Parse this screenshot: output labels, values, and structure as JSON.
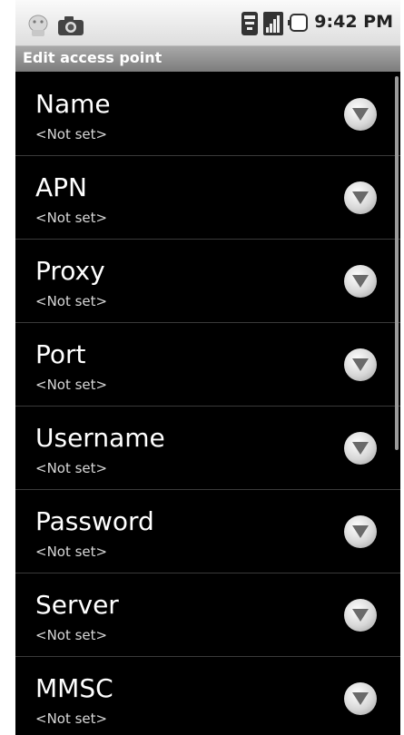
{
  "status_bar": {
    "time": "9:42 PM",
    "icons": [
      "android-icon",
      "camera-icon",
      "wifi-icon",
      "signal-icon",
      "battery-icon"
    ]
  },
  "header": {
    "title": "Edit access point"
  },
  "list": {
    "items": [
      {
        "title": "Name",
        "summary": "<Not set>"
      },
      {
        "title": "APN",
        "summary": "<Not set>"
      },
      {
        "title": "Proxy",
        "summary": "<Not set>"
      },
      {
        "title": "Port",
        "summary": "<Not set>"
      },
      {
        "title": "Username",
        "summary": "<Not set>"
      },
      {
        "title": "Password",
        "summary": "<Not set>"
      },
      {
        "title": "Server",
        "summary": "<Not set>"
      },
      {
        "title": "MMSC",
        "summary": "<Not set>"
      }
    ]
  },
  "colors": {
    "background": "#000000",
    "text": "#ffffff",
    "summary": "#d8d8d8",
    "titlebar": "#8f8f8f"
  }
}
